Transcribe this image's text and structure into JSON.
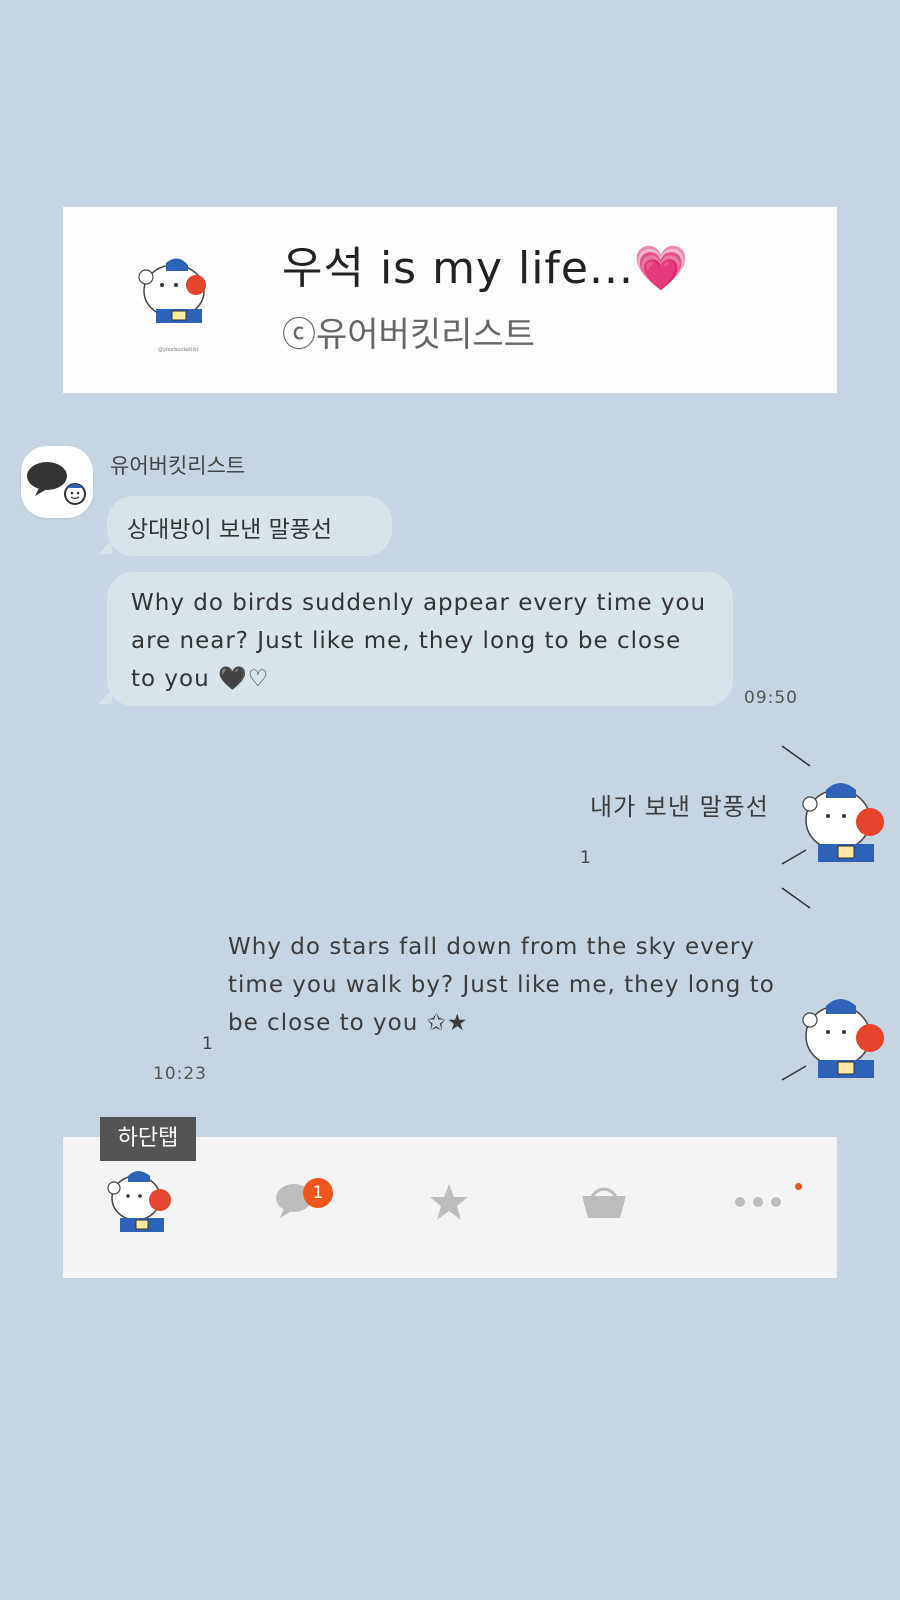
{
  "header": {
    "title": "우석 is my life...💗",
    "subtitle": "ⓒ유어버킷리스트",
    "logo_text": "@yourbucketlist"
  },
  "chat": {
    "sender_name": "유어버킷리스트",
    "received": [
      {
        "text": "상대방이 보낸 말풍선"
      },
      {
        "text": "Why do birds suddenly appear every time you are near? Just like me, they long to be close to you 🖤♡",
        "time": "09:50"
      }
    ],
    "sent": [
      {
        "text": "내가 보낸 말풍선",
        "read_count": "1"
      },
      {
        "text": "Why do stars fall down from the sky every time you walk by? Just like me, they long to be close to you ✩★",
        "read_count": "1",
        "time": "10:23"
      }
    ]
  },
  "bottom_tab": {
    "label": "하단탭",
    "chat_badge": "1",
    "items": [
      {
        "icon": "bear-friends-icon"
      },
      {
        "icon": "chat-bubble-icon"
      },
      {
        "icon": "star-icon"
      },
      {
        "icon": "shopping-basket-icon"
      },
      {
        "icon": "more-dots-icon"
      }
    ]
  },
  "colors": {
    "background": "#c6d5e1",
    "bubble": "#d8e3ea",
    "badge": "#f0551e",
    "tab_bar": "#f4f4f4"
  }
}
